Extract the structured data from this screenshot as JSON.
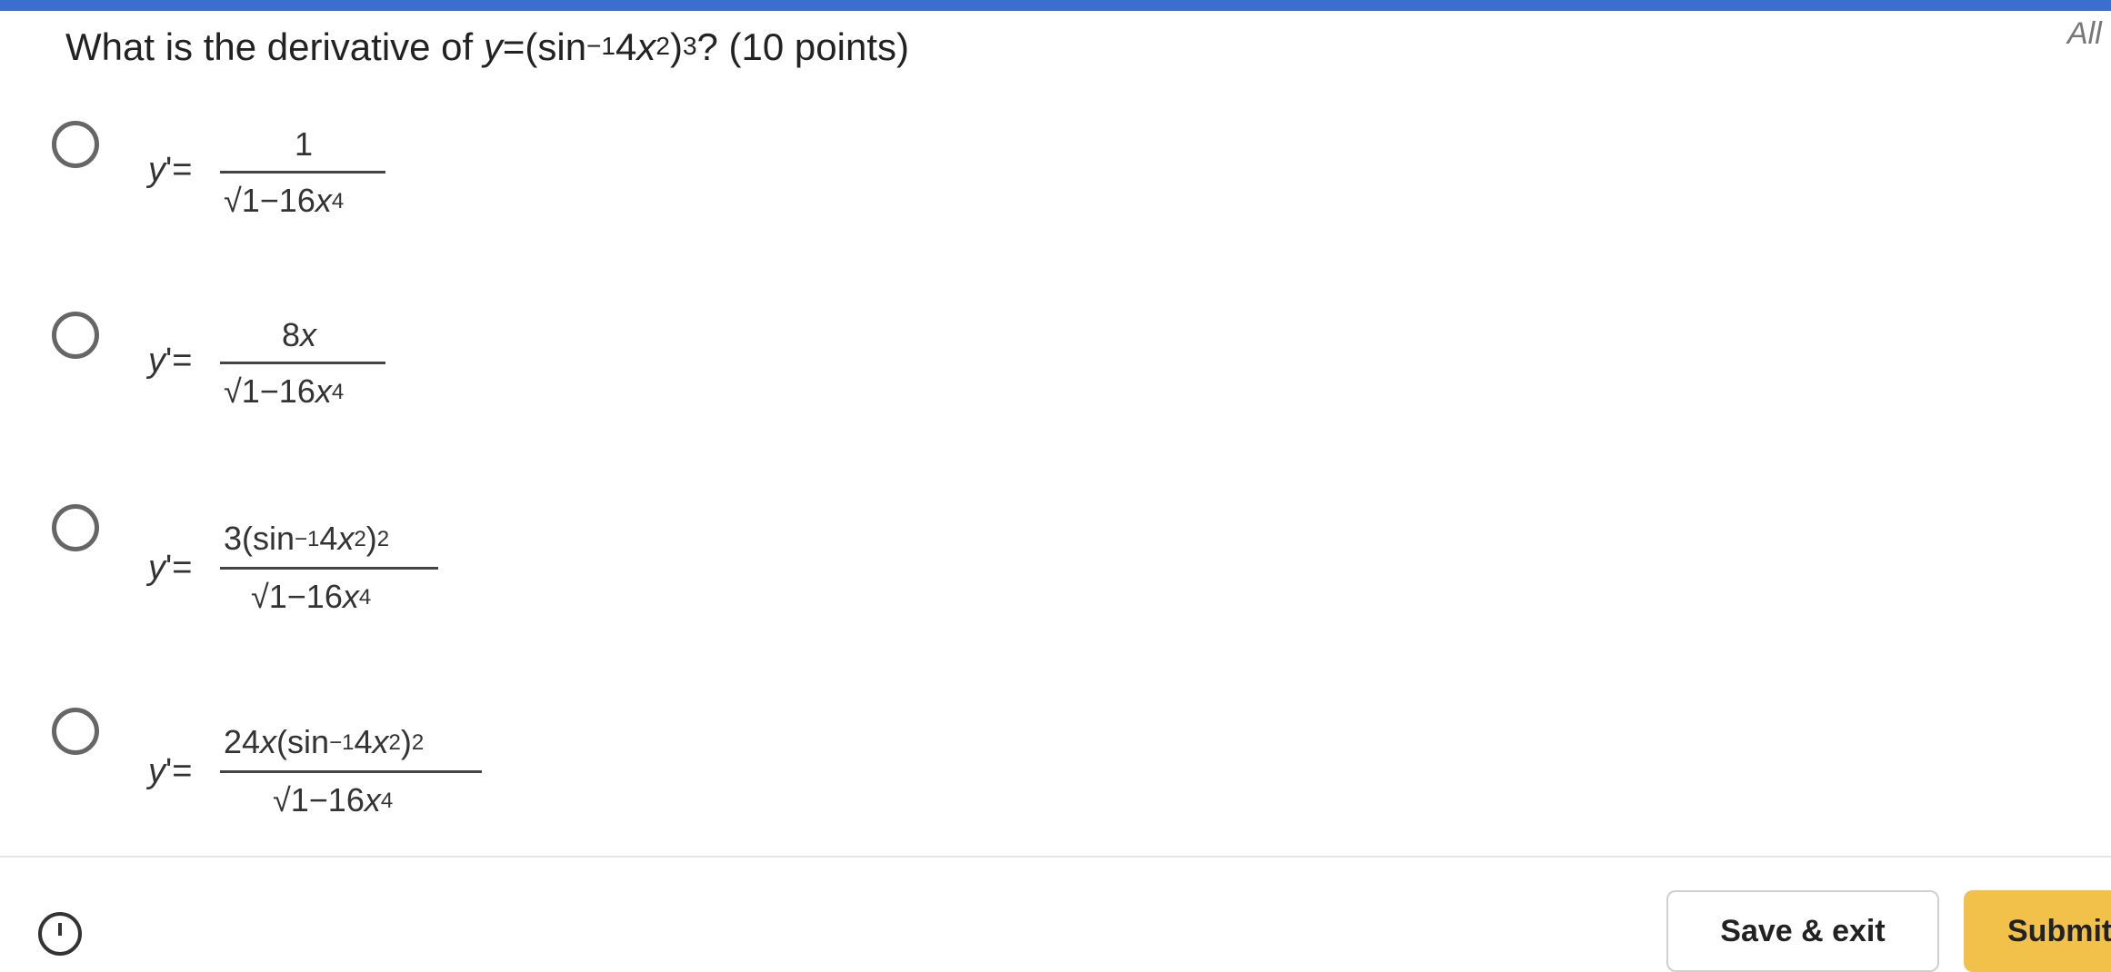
{
  "question": {
    "prefix": "What is the derivative of ",
    "y": "y",
    "eq_open": "=(sin",
    "neg_one": "−1",
    "four": "4",
    "x": "x",
    "sq": "2",
    "close": ")",
    "cube": "3",
    "suffix": "? (10 points)"
  },
  "corner_text": "All",
  "options": [
    {
      "lhs_y": "y",
      "lhs_rest": "'=",
      "numerator": "1",
      "den_main": "√1−16",
      "den_x": "x",
      "den_pow": "4"
    },
    {
      "lhs_y": "y",
      "lhs_rest": "'=",
      "num_coef": "8",
      "num_x": "x",
      "den_main": "√1−16",
      "den_x": "x",
      "den_pow": "4"
    },
    {
      "lhs_y": "y",
      "lhs_rest": "'=",
      "num_a": "3(sin",
      "num_neg_one": "−1",
      "num_b": "4",
      "num_x": "x",
      "num_sq": "2",
      "num_c": ")",
      "num_pow": "2",
      "den_main": "√1−16",
      "den_x": "x",
      "den_pow": "4"
    },
    {
      "lhs_y": "y",
      "lhs_rest": "'=",
      "num_pre": "24",
      "num_x1": "x",
      "num_a": "(sin",
      "num_neg_one": "−1",
      "num_b": "4",
      "num_x": "x",
      "num_sq": "2",
      "num_c": ")",
      "num_pow": "2",
      "den_main": "√1−16",
      "den_x": "x",
      "den_pow": "4"
    }
  ],
  "buttons": {
    "save_label": "Save & exit",
    "submit_label": "Submit"
  },
  "colors": {
    "top_bar": "#3a6fd0",
    "submit_bg": "#f2c14a",
    "radio_border": "#666666"
  },
  "icons": {
    "info": "info-icon"
  }
}
